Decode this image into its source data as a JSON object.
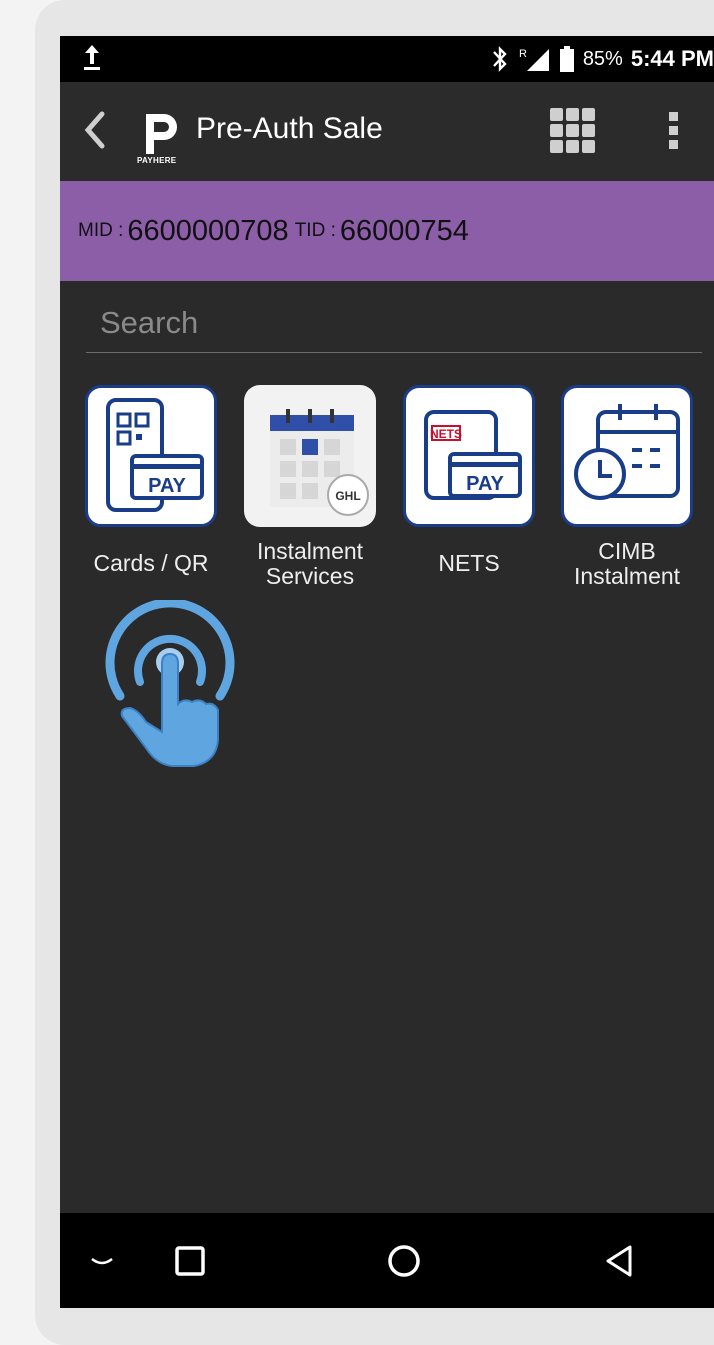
{
  "status": {
    "battery": "85%",
    "time": "5:44 PM",
    "roaming": "R"
  },
  "appbar": {
    "title": "Pre-Auth Sale",
    "logo_text": "PAYHERE"
  },
  "merchant": {
    "mid_label": "MID :",
    "mid_value": "6600000708",
    "tid_label": "TID :",
    "tid_value": "66000754"
  },
  "search": {
    "placeholder": "Search"
  },
  "tiles": [
    {
      "label": "Cards / QR",
      "icon": "cards-qr-pay-icon"
    },
    {
      "label": "Instalment Services",
      "icon": "ghl-calendar-icon",
      "badge": "GHL"
    },
    {
      "label": "NETS",
      "icon": "nets-pay-icon",
      "brand": "NETS",
      "pay": "PAY"
    },
    {
      "label": "CIMB Instalment",
      "icon": "calendar-clock-icon"
    }
  ],
  "pay_text": "PAY",
  "colors": {
    "merchant_bar": "#8c5ea8",
    "tile_border": "#1a3d8a",
    "touch_hint": "#5fa6e0"
  }
}
